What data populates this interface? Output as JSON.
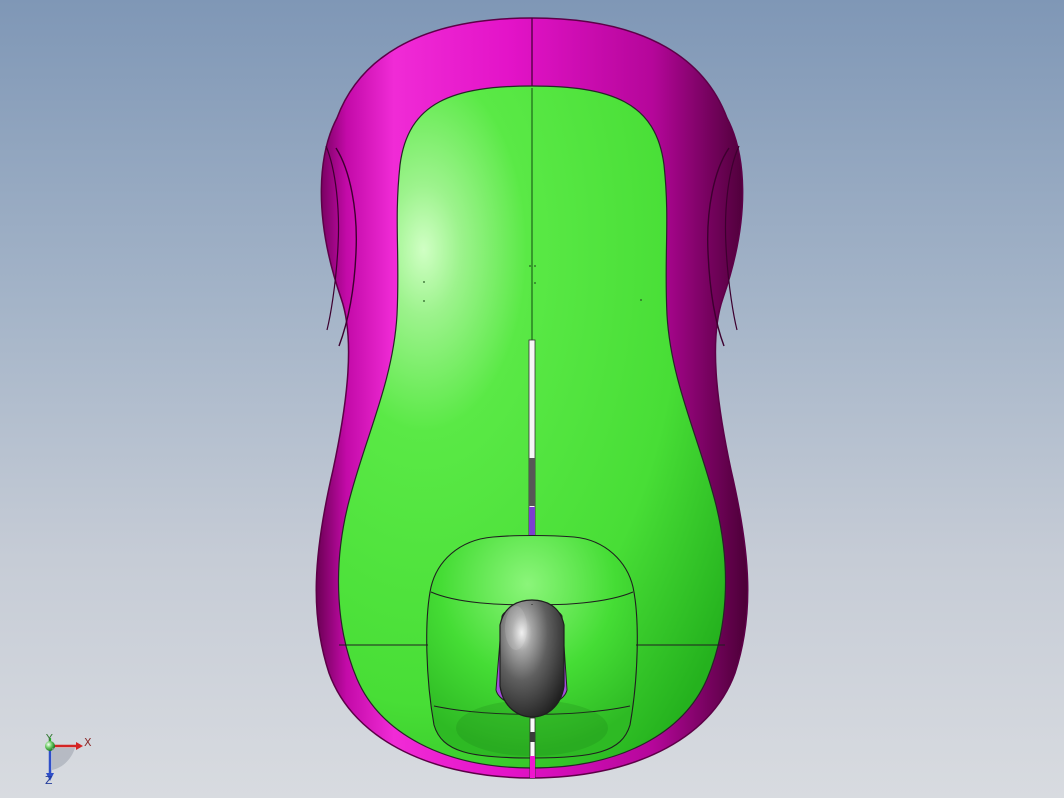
{
  "viewport": {
    "model": {
      "parts": [
        "mouse-shell",
        "top-cover",
        "scroll-wheel",
        "split-line"
      ],
      "colors": {
        "shell": "#e011c4",
        "shell_dark": "#5a003f",
        "cover": "#4ee63a",
        "cover_highlight": "#c9ffbe",
        "cover_dark": "#1e9a18",
        "wheel": "#545454",
        "wheel_highlight": "#cfcfcf",
        "wheel_slot": "#9d4fe0",
        "edge_lines": "#1b1b1b"
      }
    },
    "triad": {
      "x_label": "X",
      "y_label": "Y",
      "z_label": "Z",
      "colors": {
        "x": "#d42424",
        "y": "#29b329",
        "z": "#2f4fc9"
      }
    },
    "background": {
      "top": "#7f97b6",
      "bottom": "#d8dbe0"
    }
  }
}
